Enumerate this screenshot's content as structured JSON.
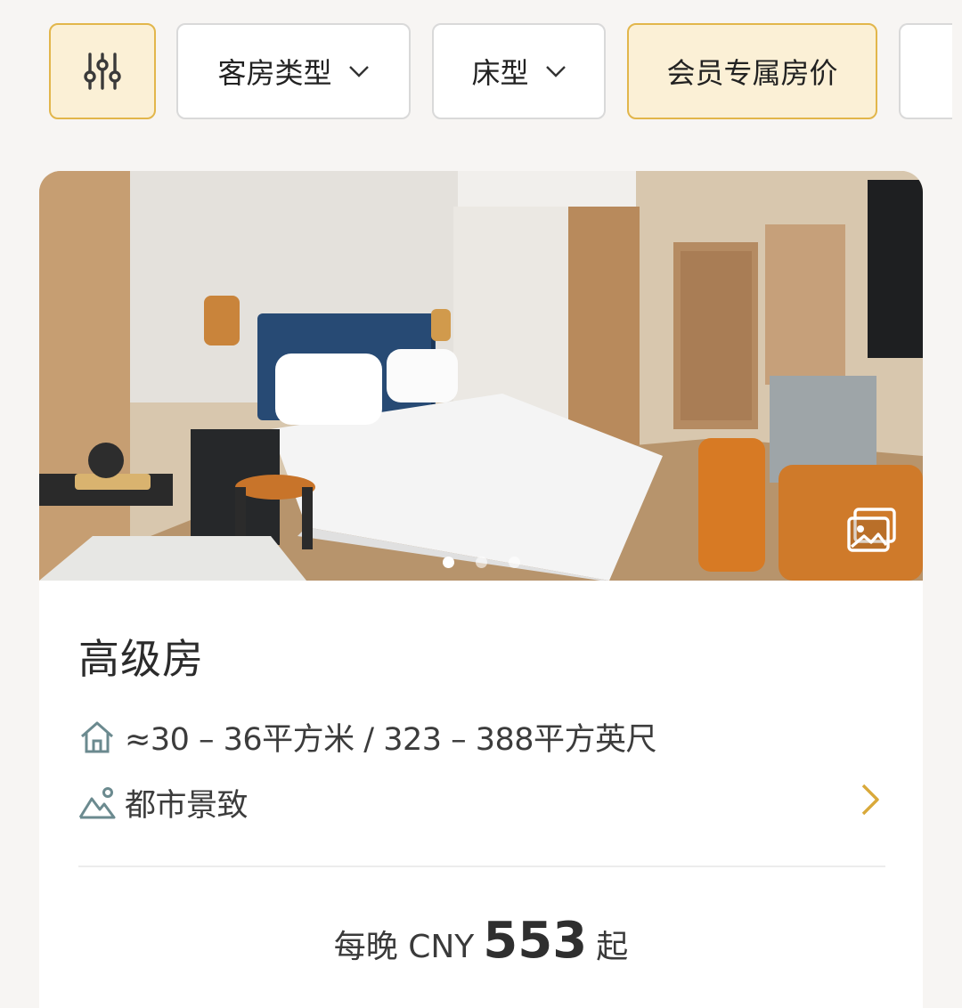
{
  "filters": {
    "filter_icon": "sliders-icon",
    "room_type_label": "客房类型",
    "bed_type_label": "床型",
    "member_rate_label": "会员专属房价"
  },
  "room": {
    "title": "高级房",
    "size_text": "≈30 – 36平方米 / 323 – 388平方英尺",
    "view_text": "都市景致",
    "gallery": {
      "image_count": 3,
      "active_index": 0
    }
  },
  "price": {
    "prefix": "每晚 CNY",
    "amount": "553",
    "suffix": "起"
  },
  "colors": {
    "accent": "#e2b64b",
    "accent_bg": "#fbf0d6",
    "icon_slate": "#6b8a8f"
  },
  "icons": {
    "size": "house-icon",
    "view": "mountain-view-icon",
    "gallery": "gallery-icon",
    "arrow": "chevron-right-icon"
  }
}
